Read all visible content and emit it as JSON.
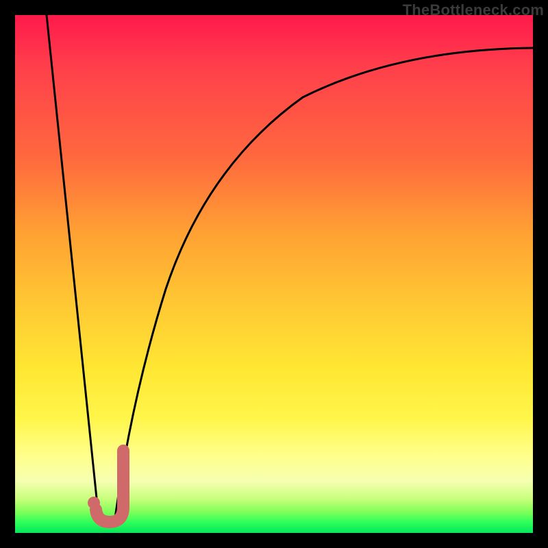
{
  "attribution": "TheBottleneck.com",
  "colors": {
    "frame": "#000000",
    "gradient_top": "#ff1a4b",
    "gradient_mid": "#ffe633",
    "gradient_bottom": "#06e55b",
    "curve": "#000000",
    "marker": "#d06a6a"
  },
  "chart_data": {
    "type": "line",
    "title": "",
    "xlabel": "",
    "ylabel": "",
    "xlim": [
      0,
      100
    ],
    "ylim": [
      0,
      100
    ],
    "series": [
      {
        "name": "left-branch",
        "x": [
          6,
          7,
          8,
          9,
          10,
          11,
          12,
          13,
          14,
          15,
          16
        ],
        "values": [
          100,
          90,
          80,
          70,
          60,
          50,
          40,
          30,
          20,
          10,
          3
        ]
      },
      {
        "name": "right-branch",
        "x": [
          19,
          20,
          22,
          25,
          28,
          32,
          37,
          43,
          50,
          58,
          67,
          77,
          88,
          100
        ],
        "values": [
          3,
          10,
          25,
          40,
          52,
          62,
          70,
          76,
          81,
          85,
          88,
          90,
          92,
          93
        ]
      }
    ],
    "markers": [
      {
        "name": "j-hook",
        "x_start": 15,
        "x_end": 20,
        "y_base": 3,
        "y_tip": 16
      }
    ]
  }
}
